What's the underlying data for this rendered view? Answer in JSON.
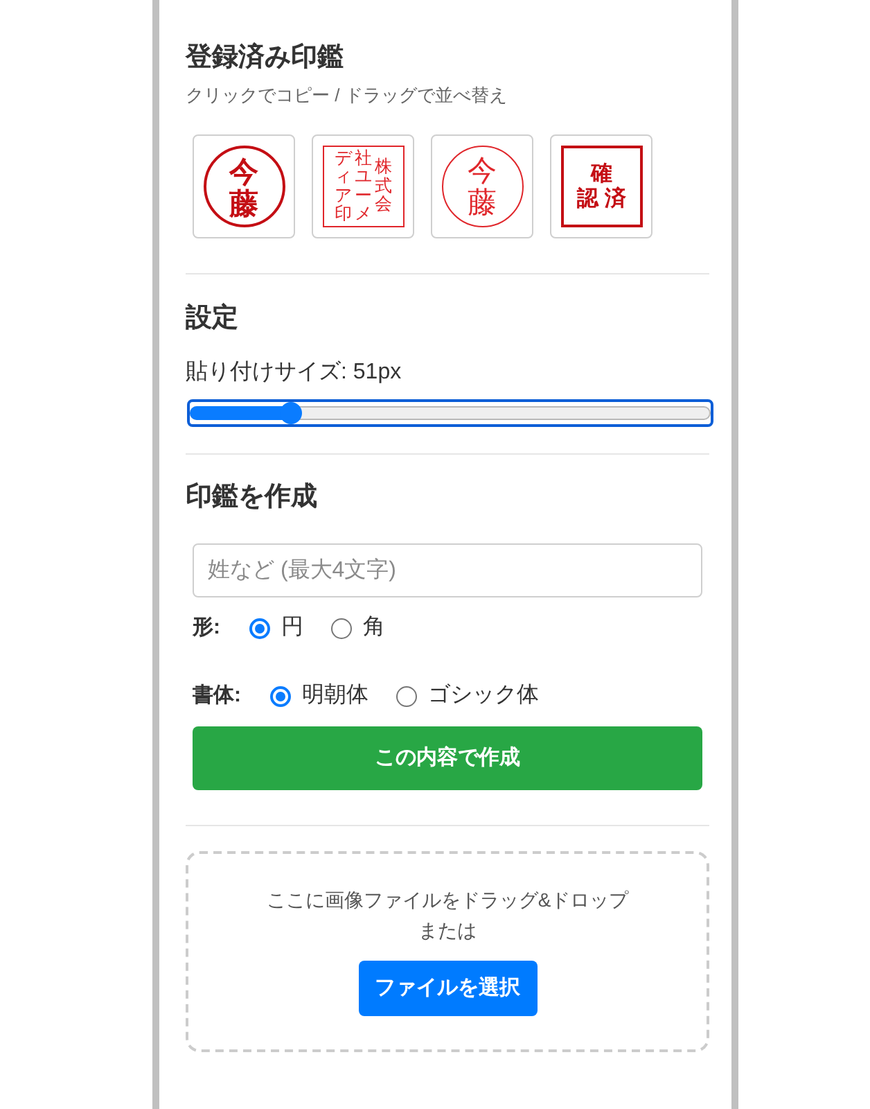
{
  "registered": {
    "title": "登録済み印鑑",
    "hint": "クリックでコピー / ドラッグで並べ替え",
    "stamps": [
      {
        "kind": "round",
        "bold": true,
        "lines": [
          "今藤"
        ]
      },
      {
        "kind": "corporate",
        "bold": false,
        "lines": [
          "ディア印",
          "社ユーメ",
          "株式会"
        ]
      },
      {
        "kind": "round",
        "bold": false,
        "lines": [
          "今藤"
        ]
      },
      {
        "kind": "approval",
        "bold": true,
        "lines": [
          "確",
          "認 済"
        ]
      }
    ]
  },
  "settings": {
    "title": "設定",
    "size_label": "貼り付けサイズ: 51px",
    "size_slider": {
      "level": 0.18,
      "focused": true
    }
  },
  "create": {
    "title": "印鑑を作成",
    "name_field": {
      "placeholder": "姓など (最大4文字)"
    },
    "option_groups": [
      {
        "label": "形:",
        "options": [
          {
            "label": "円",
            "selected": true
          },
          {
            "label": "角",
            "selected": false
          }
        ]
      },
      {
        "label": "書体:",
        "options": [
          {
            "label": "明朝体",
            "selected": true
          },
          {
            "label": "ゴシック体",
            "selected": false
          }
        ]
      }
    ],
    "submit_button": "この内容で作成"
  },
  "upload": {
    "lines": [
      "ここに画像ファイルをドラッグ&ドロップ",
      "または"
    ],
    "button": "ファイルを選択"
  }
}
